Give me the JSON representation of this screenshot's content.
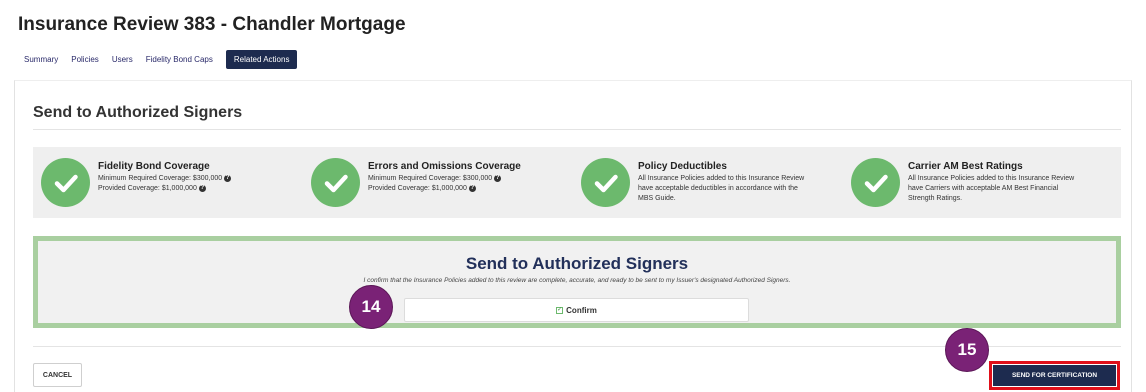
{
  "page": {
    "title": "Insurance Review 383 - Chandler Mortgage"
  },
  "tabs": [
    {
      "label": "Summary"
    },
    {
      "label": "Policies"
    },
    {
      "label": "Users"
    },
    {
      "label": "Fidelity Bond Caps"
    },
    {
      "label": "Related Actions",
      "active": true
    }
  ],
  "section": {
    "title": "Send to Authorized Signers"
  },
  "checks": [
    {
      "title": "Fidelity Bond Coverage",
      "lines": [
        "Minimum Required Coverage: $300,000",
        "Provided Coverage: $1,000,000"
      ],
      "help": true
    },
    {
      "title": "Errors and Omissions Coverage",
      "lines": [
        "Minimum Required Coverage: $300,000",
        "Provided Coverage: $1,000,000"
      ],
      "help": true
    },
    {
      "title": "Policy Deductibles",
      "lines": [
        "All Insurance Policies added to this Insurance Review",
        "have acceptable deductibles in accordance with the",
        "MBS Guide."
      ],
      "help": false
    },
    {
      "title": "Carrier AM Best Ratings",
      "lines": [
        "All Insurance Policies added to this Insurance Review",
        "have Carriers with acceptable AM Best Financial",
        "Strength Ratings."
      ],
      "help": false
    }
  ],
  "send_box": {
    "title": "Send to Authorized Signers",
    "subtitle": "I confirm that the Insurance Policies added to this review are complete, accurate, and ready to be sent to my Issuer's designated Authorized Signers.",
    "confirm_label": "Confirm"
  },
  "actions": {
    "cancel_label": "CANCEL",
    "send_label": "SEND FOR CERTIFICATION"
  },
  "markers": {
    "confirm": "14",
    "send": "15"
  },
  "colors": {
    "brand_navy": "#1d2b4f",
    "success_green": "#6cb96d",
    "send_border": "#a9cfa0",
    "highlight_red": "#e0101a",
    "marker_purple": "#7a2276"
  }
}
